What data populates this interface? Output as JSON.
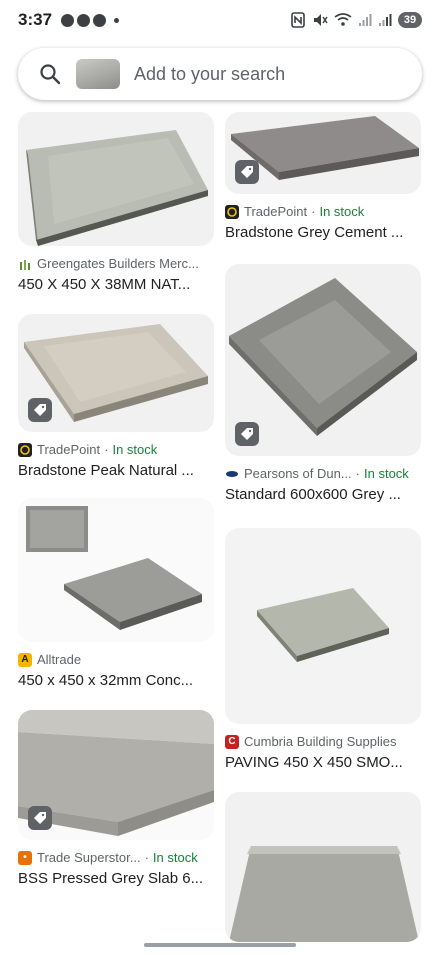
{
  "status_bar": {
    "time": "3:37",
    "battery": "39"
  },
  "search": {
    "placeholder": "Add to your search"
  },
  "results": [
    {
      "source": "Greengates Builders Merc...",
      "stock": "",
      "title": "450 X 450 X 38MM NAT..."
    },
    {
      "source": "TradePoint",
      "stock": "In stock",
      "title": "Bradstone Grey Cement ..."
    },
    {
      "source": "TradePoint",
      "stock": "In stock",
      "title": "Bradstone Peak Natural ..."
    },
    {
      "source": "Pearsons of Dun...",
      "stock": "In stock",
      "title": "Standard 600x600 Grey ..."
    },
    {
      "source": "Alltrade",
      "stock": "",
      "title": "450 x 450 x 32mm Conc..."
    },
    {
      "source": "Cumbria Building Supplies",
      "stock": "",
      "title": "PAVING 450 X 450 SMO..."
    },
    {
      "source": "Trade Superstor...",
      "stock": "In stock",
      "title": "BSS Pressed Grey Slab 6..."
    }
  ],
  "separator": "·",
  "colors": {
    "in_stock": "#188038",
    "text_primary": "#202124",
    "text_secondary": "#5f6368",
    "card_bg": "#f1f1f1"
  },
  "icons": [
    "search-icon",
    "tag-icon",
    "nfc-icon",
    "mute-icon",
    "wifi-icon",
    "signal-icon",
    "battery-icon"
  ]
}
